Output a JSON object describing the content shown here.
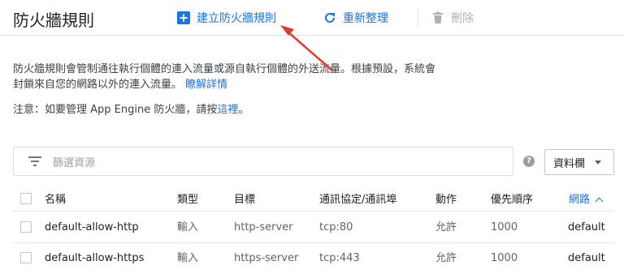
{
  "header": {
    "title": "防火牆規則",
    "create_label": "建立防火牆規則",
    "refresh_label": "重新整理",
    "delete_label": "刪除"
  },
  "description": {
    "text": "防火牆規則會管制通往執行個體的連入流量或源自執行個體的外送流量。根據預設，系統會封鎖來自您的網路以外的連入流量。",
    "learn_more": "瞭解詳情"
  },
  "note": {
    "prefix": "注意：如要管理 App Engine 防火牆，請按",
    "link": "這裡",
    "suffix": "。"
  },
  "filter": {
    "placeholder": "篩選資源",
    "columns_label": "資料欄",
    "help": "?"
  },
  "table": {
    "headers": {
      "name": "名稱",
      "type": "類型",
      "targets": "目標",
      "protocols": "通訊協定/通訊埠",
      "action": "動作",
      "priority": "優先順序",
      "network": "網路"
    },
    "rows": [
      {
        "name": "default-allow-http",
        "type": "輸入",
        "targets": "http-server",
        "protocols": "tcp:80",
        "action": "允許",
        "priority": "1000",
        "network": "default"
      },
      {
        "name": "default-allow-https",
        "type": "輸入",
        "targets": "https-server",
        "protocols": "tcp:443",
        "action": "允許",
        "priority": "1000",
        "network": "default"
      }
    ]
  },
  "colors": {
    "accent": "#1a73e8",
    "annotation_arrow": "#e53935"
  }
}
